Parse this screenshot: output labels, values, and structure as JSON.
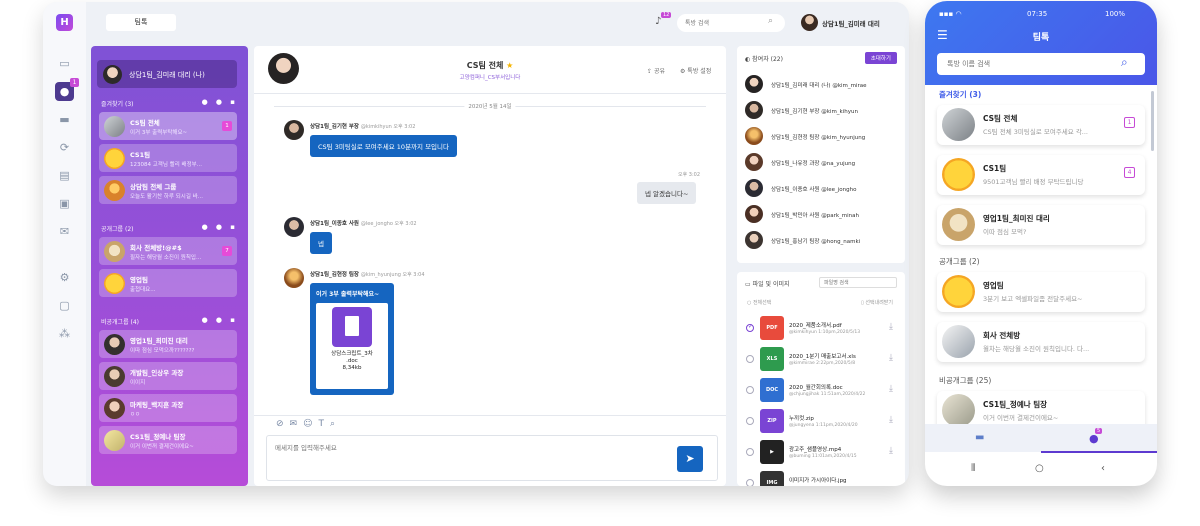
{
  "desktop": {
    "top_tab": "팀톡",
    "notif_count": "12",
    "search_placeholder": "톡방 검색",
    "me_name": "상담1팀_김미래 대리",
    "rail_badge": "1"
  },
  "left_panel": {
    "me_label": "상담1팀_김미래 대리 (나)",
    "fav_header": "즐겨찾기 (3)",
    "public_header": "공개그룹 (2)",
    "private_header": "비공개그룹 (4)",
    "favorites": [
      {
        "name": "CS팀 전체",
        "msg": "이거 3부 출력부탁해요~",
        "count": "1"
      },
      {
        "name": "CS1팀",
        "msg": "123084 고객님 빨리 배정부...",
        "count": ""
      },
      {
        "name": "상담팀 전체 그룹",
        "msg": "오늘도 활기찬 하루 되시길 바...",
        "count": ""
      }
    ],
    "public": [
      {
        "name": "회사 전체방!@#$",
        "msg": "필자는 해당월 소진이 원칙입...",
        "count": "7"
      },
      {
        "name": "영업팀",
        "msg": "출첩대요...",
        "count": ""
      }
    ],
    "private": [
      {
        "name": "영업1팀_최미진 대리",
        "msg": "이따 점심 모먹으까???????",
        "count": ""
      },
      {
        "name": "개발팀_인상우 과장",
        "msg": "이이지",
        "count": ""
      },
      {
        "name": "마케팅_백지훈 과장",
        "msg": "ㅇㅇ",
        "count": ""
      },
      {
        "name": "CS1팀_정예나 팀장",
        "msg": "이거 이번꺼 결제건이에요~",
        "count": ""
      }
    ]
  },
  "chat": {
    "title": "CS팀 전체",
    "subtitle": "고양컴퍼니_CS부서입니다",
    "share_label": "공유",
    "settings_label": "톡방 설정",
    "date": "2020년 5월 14일",
    "messages": [
      {
        "sender": "상담1팀_김기현 부장",
        "handle": "@kimkihyun 오후 3:02",
        "text": "CS팀 3미팅실로 모여주세요 10분까지 모입니다"
      },
      {
        "time": "오후 3:02",
        "text": "넵 알겠습니다~"
      },
      {
        "sender": "상담1팀_이종호 사원",
        "handle": "@lee_jongho 오후 3:02",
        "text": "넵"
      },
      {
        "sender": "상담1팀_김현정 팀장",
        "handle": "@kim_hyunjung 오후 3:04",
        "text": "이거 3부 출력부탁해요~",
        "file_name": "상담스크립트_3차",
        "file_ext": ".doc",
        "file_size": "8,34kb"
      }
    ],
    "input_placeholder": "메세지를 입력해주세요"
  },
  "participants": {
    "header": "참여자 (22)",
    "invite_label": "초대하기",
    "list": [
      "상담1팀_김미래 대리 (나) @kim_mirae",
      "상담1팀_김기현 부장 @kim_kihyun",
      "상담1팀_김현정 팀장 @kim_hyunjung",
      "상담1팀_나유정 과장 @na_yujung",
      "상담1팀_이종호 사원 @lee_jongho",
      "상담1팀_박민아 사원 @park_minah",
      "상담1팀_홍남기 팀장 @hong_namki"
    ]
  },
  "files": {
    "header": "파일 및 이미지",
    "search_placeholder": "파일명 검색",
    "select_all": "전체선택",
    "download_selected": "선택내려받기",
    "list": [
      {
        "icon": "PDF",
        "color": "#e84b3c",
        "name": "2020_제품소개서.pdf",
        "meta": "@kimkihyun 1:10pm,2020/5/13",
        "checked": true
      },
      {
        "icon": "XLS",
        "color": "#2e9b4e",
        "name": "2020_1분기 매출보고서.xls",
        "meta": "@kimmirae 2:22pm,2020/5/8",
        "checked": false
      },
      {
        "icon": "DOC",
        "color": "#2f6fd1",
        "name": "2020_월간회의록.doc",
        "meta": "@chjungjihak 11:51am,2020/4/22",
        "checked": false
      },
      {
        "icon": "ZIP",
        "color": "#7a44d4",
        "name": "누끼컷.zip",
        "meta": "@jungyena 1:11pm,2020/4/20",
        "checked": false
      },
      {
        "icon": "▶",
        "color": "#222222",
        "name": "광고주_샘플영상.mp4",
        "meta": "@buming 11:01am,2020/4/15",
        "checked": false
      },
      {
        "icon": "IMG",
        "color": "#333333",
        "name": "이미지가 가시아이다.jpg",
        "meta": "",
        "checked": false
      }
    ]
  },
  "mobile": {
    "time": "07:35",
    "battery": "100%",
    "title": "팀톡",
    "search_placeholder": "톡방 이름 검색",
    "fav_header": "즐겨찾기 (3)",
    "public_header": "공개그룹 (2)",
    "private_header": "비공개그룹 (25)",
    "favorites": [
      {
        "name": "CS팀 전체",
        "msg": "CS팀 전체 3미팅실로 모여주세요 각...",
        "count": "1"
      },
      {
        "name": "CS1팀",
        "msg": "9501고객님 빨리 배정 부탁드립니당",
        "count": "4"
      },
      {
        "name": "영업1팀_최미진 대리",
        "msg": "이따 점심 모먹?",
        "count": ""
      }
    ],
    "public": [
      {
        "name": "영업팀",
        "msg": "3분기 보고 엑셀파일좀 전달주세요~",
        "count": ""
      },
      {
        "name": "회사 전체방",
        "msg": "월차는 해당월 소진이 원칙입니다. 다...",
        "count": ""
      }
    ],
    "private": [
      {
        "name": "CS1팀_정예나 팀장",
        "msg": "이거 이번꺼 결제건이에요~",
        "count": ""
      }
    ],
    "tab_badge": "5"
  }
}
